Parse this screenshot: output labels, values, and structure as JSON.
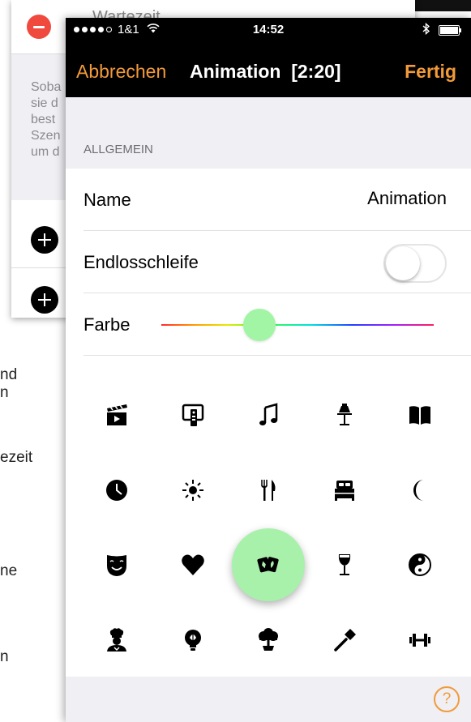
{
  "background_text": [
    {
      "text": "nd"
    },
    {
      "text": "n"
    },
    {
      "text": "ezeit"
    },
    {
      "text": "ne"
    },
    {
      "text": "n"
    }
  ],
  "back_card": {
    "title": "Wartezeit",
    "info_lines": [
      "Soba",
      "sie d",
      "best",
      "Szen",
      "um d"
    ]
  },
  "status_bar": {
    "carrier": "1&1",
    "time": "14:52"
  },
  "nav": {
    "cancel": "Abbrechen",
    "title": "Animation  [2:20]",
    "done": "Fertig"
  },
  "section": {
    "header": "ALLGEMEIN"
  },
  "rows": {
    "name_label": "Name",
    "name_value": "Animation",
    "loop_label": "Endlosschleife",
    "loop_on": false,
    "color_label": "Farbe",
    "color_position": 0.36
  },
  "icons": [
    {
      "name": "clapperboard-icon"
    },
    {
      "name": "tv-remote-icon"
    },
    {
      "name": "music-note-icon"
    },
    {
      "name": "desk-lamp-icon"
    },
    {
      "name": "book-icon"
    },
    {
      "name": "clock-icon"
    },
    {
      "name": "sun-icon"
    },
    {
      "name": "fork-knife-icon"
    },
    {
      "name": "bed-icon"
    },
    {
      "name": "moon-icon"
    },
    {
      "name": "theater-mask-icon"
    },
    {
      "name": "heart-icon"
    },
    {
      "name": "playing-cards-icon",
      "selected": true
    },
    {
      "name": "wine-glass-icon"
    },
    {
      "name": "yin-yang-icon"
    },
    {
      "name": "chef-icon"
    },
    {
      "name": "lightbulb-icon"
    },
    {
      "name": "tree-icon"
    },
    {
      "name": "hammer-icon"
    },
    {
      "name": "dumbbell-icon"
    }
  ],
  "colors": {
    "accent": "#f29a3a",
    "selected_bg": "#a8f1ab",
    "delete": "#f0493e"
  },
  "help": "?"
}
